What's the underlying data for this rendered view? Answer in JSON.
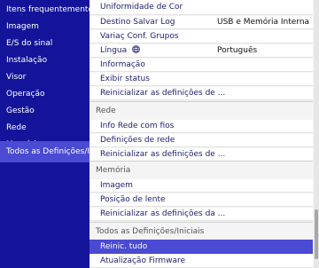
{
  "sidebar": {
    "items": [
      {
        "label": "Itens frequentemente ..."
      },
      {
        "label": "Imagem"
      },
      {
        "label": "E/S do sinal"
      },
      {
        "label": "Instalação"
      },
      {
        "label": "Visor"
      },
      {
        "label": "Operação"
      },
      {
        "label": "Gestão"
      },
      {
        "label": "Rede"
      },
      {
        "label": "Memória"
      },
      {
        "label": "Todos as Definições/Inici..."
      }
    ],
    "selected_index": 9
  },
  "panel": {
    "rows_top": [
      {
        "label": "Uniformidade de Cor",
        "value": ""
      },
      {
        "label": "Destino Salvar Log",
        "value": "USB e Memória Interna"
      },
      {
        "label": "Variaç Conf. Grupos",
        "value": ""
      },
      {
        "label": "Língua",
        "value": "Português",
        "icon": "globe-icon"
      },
      {
        "label": "Informação",
        "value": ""
      },
      {
        "label": "Exibir status",
        "value": ""
      },
      {
        "label": "Reinicializar as definições de ...",
        "value": ""
      }
    ],
    "section_rede": {
      "title": "Rede",
      "rows": [
        {
          "label": "Info Rede com fios"
        },
        {
          "label": "Definições de rede"
        },
        {
          "label": "Reinicializar as definições de ..."
        }
      ]
    },
    "section_memoria": {
      "title": "Memória",
      "rows": [
        {
          "label": "Imagem"
        },
        {
          "label": "Posição de lente"
        },
        {
          "label": "Reinicializar as definições da ..."
        }
      ]
    },
    "section_todos": {
      "title": "Todos as Definições/Iniciais",
      "rows": [
        {
          "label": "Reinic. tudo",
          "selected": true
        },
        {
          "label": "Atualização Firmware"
        }
      ]
    }
  },
  "colors": {
    "sidebar_bg": "#14149a",
    "selection": "#4a4ad2",
    "panel_bg": "#f4f4f4",
    "row_text": "#1c1c6e"
  }
}
